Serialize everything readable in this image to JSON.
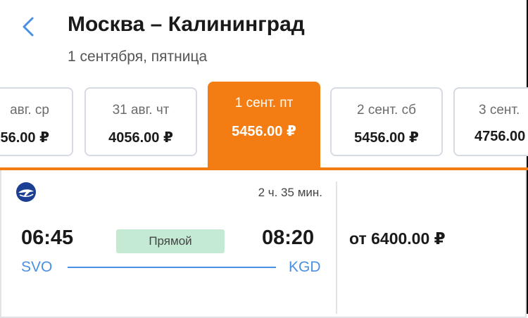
{
  "header": {
    "title": "Москва – Калининград",
    "subtitle": "1 сентября, пятница"
  },
  "dates": [
    {
      "label": "авг. ср",
      "price": "56.00 ₽"
    },
    {
      "label": "31 авг. чт",
      "price": "4056.00 ₽"
    },
    {
      "label": "1 сент. пт",
      "price": "5456.00 ₽"
    },
    {
      "label": "2 сент. сб",
      "price": "5456.00 ₽"
    },
    {
      "label": "3 сент.",
      "price": "4756.00"
    }
  ],
  "flight": {
    "duration": "2 ч. 35 мин.",
    "departure_time": "06:45",
    "arrival_time": "08:20",
    "type": "Прямой",
    "departure_code": "SVO",
    "arrival_code": "KGD",
    "price": "от 6400.00 ₽"
  },
  "icons": {
    "back": "chevron-left-icon",
    "airline": "airline-logo-icon"
  },
  "colors": {
    "accent": "#f47d13",
    "link": "#4a90e2",
    "badge": "#c4ead3"
  }
}
